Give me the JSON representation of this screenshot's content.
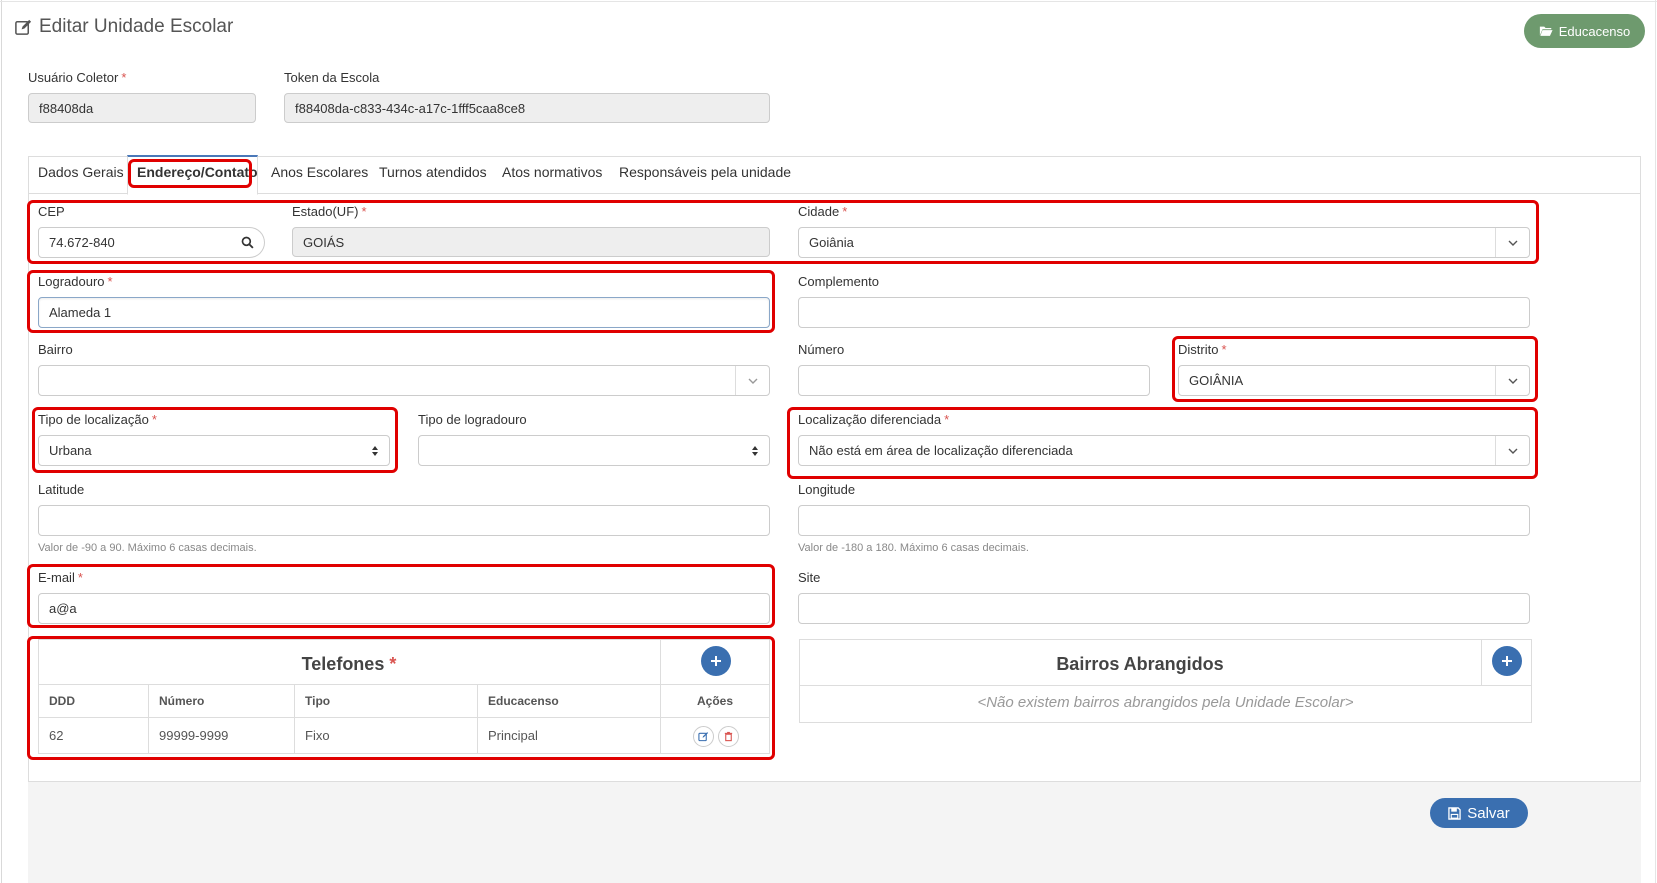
{
  "page": {
    "title": "Editar Unidade Escolar",
    "educacenso_button": "Educacenso",
    "save_button": "Salvar"
  },
  "header_fields": {
    "usuario_coletor": {
      "label": "Usuário Coletor",
      "required": "*",
      "value": "f88408da"
    },
    "token_escola": {
      "label": "Token da Escola",
      "value": "f88408da-c833-434c-a17c-1fff5caa8ce8"
    }
  },
  "tabs": [
    {
      "label": "Dados Gerais"
    },
    {
      "label": "Endereço/Contato"
    },
    {
      "label": "Anos Escolares"
    },
    {
      "label": "Turnos atendidos"
    },
    {
      "label": "Atos normativos"
    },
    {
      "label": "Responsáveis pela unidade"
    }
  ],
  "active_tab": "Endereço/Contato",
  "form": {
    "cep": {
      "label": "CEP",
      "value": "74.672-840"
    },
    "estado": {
      "label": "Estado(UF)",
      "required": "*",
      "value": "GOIÁS"
    },
    "cidade": {
      "label": "Cidade",
      "required": "*",
      "value": "Goiânia"
    },
    "logradouro": {
      "label": "Logradouro",
      "required": "*",
      "value": "Alameda 1"
    },
    "complemento": {
      "label": "Complemento",
      "value": ""
    },
    "bairro": {
      "label": "Bairro",
      "value": ""
    },
    "numero": {
      "label": "Número",
      "value": ""
    },
    "distrito": {
      "label": "Distrito",
      "required": "*",
      "value": "GOIÂNIA"
    },
    "tipo_localizacao": {
      "label": "Tipo de localização",
      "required": "*",
      "value": "Urbana"
    },
    "tipo_logradouro": {
      "label": "Tipo de logradouro",
      "value": ""
    },
    "localizacao_diferenciada": {
      "label": "Localização diferenciada",
      "required": "*",
      "value": "Não está em área de localização diferenciada"
    },
    "latitude": {
      "label": "Latitude",
      "value": "",
      "help": "Valor de -90 a 90. Máximo 6 casas decimais."
    },
    "longitude": {
      "label": "Longitude",
      "value": "",
      "help": "Valor de -180 a 180. Máximo 6 casas decimais."
    },
    "email": {
      "label": "E-mail",
      "required": "*",
      "value": "a@a"
    },
    "site": {
      "label": "Site",
      "value": ""
    }
  },
  "telefones": {
    "title": "Telefones",
    "required": "*",
    "columns": [
      "DDD",
      "Número",
      "Tipo",
      "Educacenso",
      "Ações"
    ],
    "rows": [
      {
        "ddd": "62",
        "numero": "99999-9999",
        "tipo": "Fixo",
        "educacenso": "Principal"
      }
    ]
  },
  "bairros": {
    "title": "Bairros Abrangidos",
    "empty": "<Não existem bairros abrangidos pela Unidade Escolar>"
  },
  "colors": {
    "highlight": "#e00000",
    "primary": "#3a6fb0",
    "educacenso": "#6e9a6e",
    "required": "#d9534f"
  }
}
